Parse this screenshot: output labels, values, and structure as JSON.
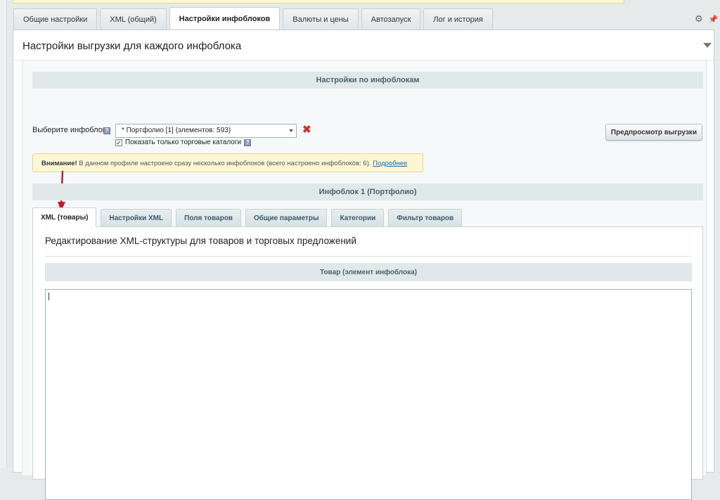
{
  "main_tabs": [
    {
      "label": "Общие настройки",
      "active": false
    },
    {
      "label": "XML (общий)",
      "active": false
    },
    {
      "label": "Настройки инфоблоков",
      "active": true
    },
    {
      "label": "Валюты и цены",
      "active": false
    },
    {
      "label": "Автозапуск",
      "active": false
    },
    {
      "label": "Лог и история",
      "active": false
    }
  ],
  "panel": {
    "title": "Настройки выгрузки для каждого инфоблока"
  },
  "iblock_settings": {
    "section_title": "Настройки по инфоблокам",
    "select_label": "Выберите инфоблок:",
    "select_value": "* Портфолио [1] (элементов: 593)",
    "checkbox_label": "Показать только торговые каталоги",
    "checkbox_checked": true,
    "preview_button": "Предпросмотр выгрузки"
  },
  "warning": {
    "strong": "Внимание!",
    "text": " В данном профиле настроено сразу несколько инфоблоков (всего настроено инфоблоков: 6). ",
    "link": "Подробнее"
  },
  "iblock_section": {
    "title": "Инфоблок 1 (Портфолио)"
  },
  "sub_tabs": [
    {
      "label": "XML (товары)",
      "active": true
    },
    {
      "label": "Настройки XML",
      "active": false
    },
    {
      "label": "Поля товаров",
      "active": false
    },
    {
      "label": "Общие параметры",
      "active": false
    },
    {
      "label": "Категории",
      "active": false
    },
    {
      "label": "Фильтр товаров",
      "active": false
    }
  ],
  "content": {
    "title": "Редактирование XML-структуры для товаров и торговых предложений",
    "product_section": "Товар (элемент инфоблока)",
    "xml_value": ""
  },
  "icons": {
    "settings": "gear-icon",
    "pin": "pin-icon",
    "help": "help-icon",
    "remove": "remove-icon"
  },
  "colors": {
    "accent_link": "#2067b0",
    "warning_bg": "#fcf6d5",
    "remove_red": "#d0312c",
    "arrow_red": "#c0191f"
  }
}
